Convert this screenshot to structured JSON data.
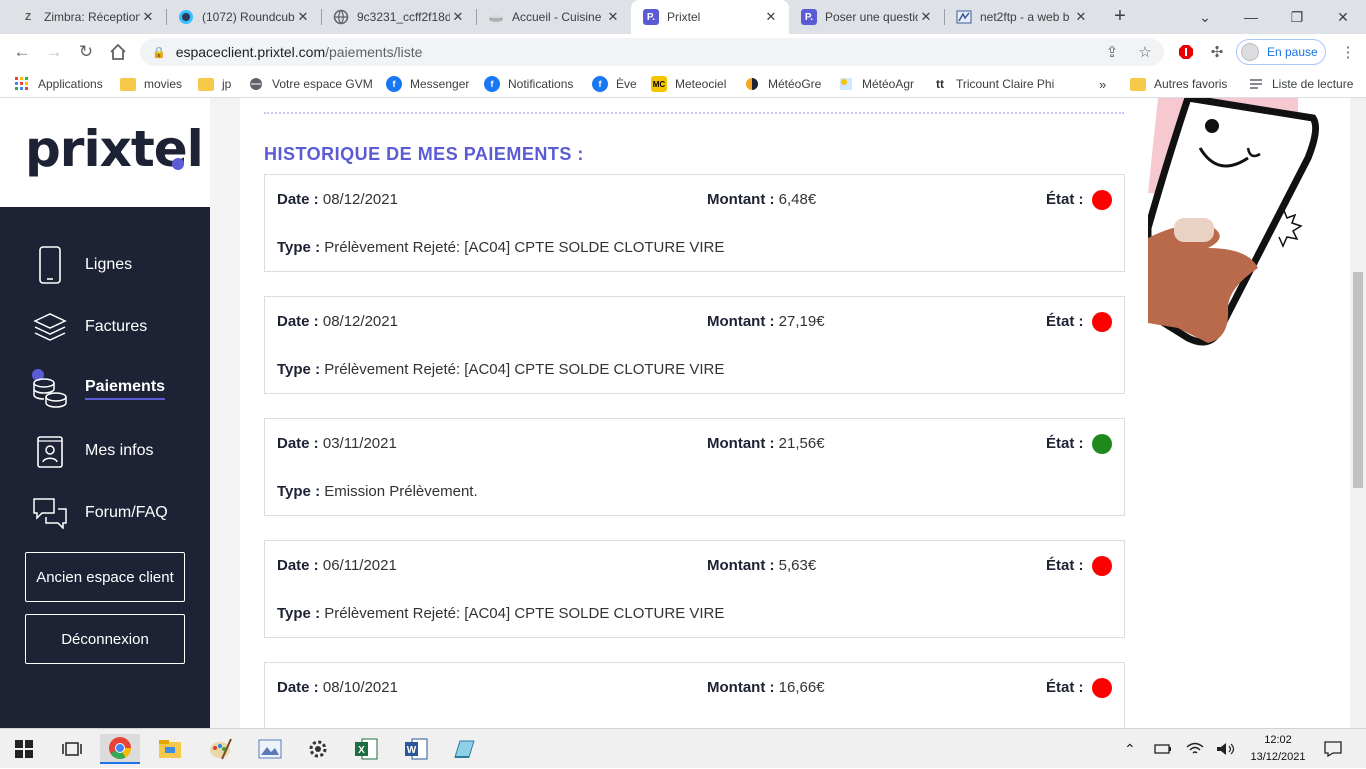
{
  "browser": {
    "tabs": [
      {
        "title": "Zimbra: Réception",
        "icon": "zimbra-icon",
        "active": false
      },
      {
        "title": "(1072) Roundcube",
        "icon": "roundcube-icon",
        "active": false
      },
      {
        "title": "9c3231_ccff2f18d",
        "icon": "globe-icon",
        "active": false
      },
      {
        "title": "Accueil - Cuisine",
        "icon": "cuisine-icon",
        "active": false
      },
      {
        "title": "Prixtel",
        "icon": "prixtel-icon",
        "active": true
      },
      {
        "title": "Poser une questio",
        "icon": "prixtel-icon",
        "active": false
      },
      {
        "title": "net2ftp - a web b",
        "icon": "net2ftp-icon",
        "active": false
      }
    ],
    "url_host": "espaceclient.prixtel.com",
    "url_path": "/paiements/liste",
    "profile_status": "En pause",
    "bookmarks": [
      {
        "label": "Applications",
        "icon": "apps-grid-icon"
      },
      {
        "label": "movies",
        "icon": "folder-icon"
      },
      {
        "label": "jp",
        "icon": "folder-icon"
      },
      {
        "label": "Votre espace GVM",
        "icon": "globe-icon"
      },
      {
        "label": "Messenger",
        "icon": "facebook-icon"
      },
      {
        "label": "Notifications",
        "icon": "facebook-icon"
      },
      {
        "label": "Ève",
        "icon": "facebook-icon"
      },
      {
        "label": "Meteociel",
        "icon": "meteociel-icon"
      },
      {
        "label": "MétéoGre",
        "icon": "meteogre-icon"
      },
      {
        "label": "MétéoAgr",
        "icon": "meteoagr-icon"
      },
      {
        "label": "Tricount Claire Phi",
        "icon": "tricount-icon"
      }
    ],
    "other_bookmarks": "Autres favoris",
    "reading_list": "Liste de lecture"
  },
  "sidebar": {
    "logo": "prixtel",
    "items": [
      {
        "label": "Lignes",
        "icon": "phone-icon",
        "active": false
      },
      {
        "label": "Factures",
        "icon": "stack-icon",
        "active": false
      },
      {
        "label": "Paiements",
        "icon": "coins-icon",
        "active": true
      },
      {
        "label": "Mes infos",
        "icon": "contact-card-icon",
        "active": false
      },
      {
        "label": "Forum/FAQ",
        "icon": "chat-bubbles-icon",
        "active": false
      }
    ],
    "old_space_button": "Ancien espace client",
    "logout_button": "Déconnexion"
  },
  "main": {
    "section_title": "HISTORIQUE DE MES PAIEMENTS :",
    "labels": {
      "date": "Date :",
      "amount": "Montant :",
      "state": "État :",
      "type": "Type :"
    },
    "payments": [
      {
        "date": "08/12/2021",
        "amount": "6,48€",
        "state": "rejected",
        "type": "Prélèvement Rejeté: [AC04] CPTE SOLDE CLOTURE VIRE"
      },
      {
        "date": "08/12/2021",
        "amount": "27,19€",
        "state": "rejected",
        "type": "Prélèvement Rejeté: [AC04] CPTE SOLDE CLOTURE VIRE"
      },
      {
        "date": "03/11/2021",
        "amount": "21,56€",
        "state": "ok",
        "type": "Emission Prélèvement."
      },
      {
        "date": "06/11/2021",
        "amount": "5,63€",
        "state": "rejected",
        "type": "Prélèvement Rejeté: [AC04] CPTE SOLDE CLOTURE VIRE"
      },
      {
        "date": "08/10/2021",
        "amount": "16,66€",
        "state": "rejected",
        "type": ""
      }
    ]
  },
  "colors": {
    "accent": "#5b5bd6",
    "sidebar": "#1d2235",
    "state_rejected": "#ff0000",
    "state_ok": "#1e8a1e"
  },
  "taskbar": {
    "time": "12:02",
    "date": "13/12/2021"
  }
}
